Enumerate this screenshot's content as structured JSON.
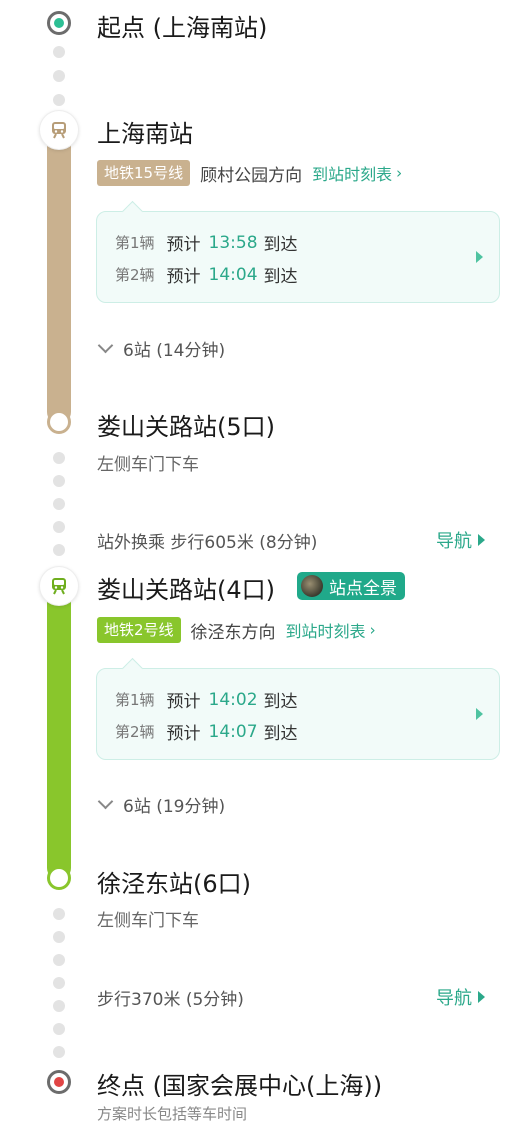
{
  "start": {
    "label": "起点 (上海南站)"
  },
  "segment1": {
    "station": "上海南站",
    "line": "地铁15号线",
    "direction": "顾村公园方向",
    "timetable": "到站时刻表",
    "arrivals": [
      {
        "idx": "第1辆",
        "pre": "预计",
        "time": "13:58",
        "suf": "到达"
      },
      {
        "idx": "第2辆",
        "pre": "预计",
        "time": "14:04",
        "suf": "到达"
      }
    ],
    "stops": "6站 (14分钟)",
    "exit_station": "娄山关路站(5口)",
    "door": "左侧车门下车",
    "color": "#c9b18f"
  },
  "transfer": {
    "text": "站外换乘 步行605米 (8分钟)",
    "nav": "导航"
  },
  "segment2": {
    "station": "娄山关路站(4口)",
    "panorama": "站点全景",
    "line": "地铁2号线",
    "direction": "徐泾东方向",
    "timetable": "到站时刻表",
    "arrivals": [
      {
        "idx": "第1辆",
        "pre": "预计",
        "time": "14:02",
        "suf": "到达"
      },
      {
        "idx": "第2辆",
        "pre": "预计",
        "time": "14:07",
        "suf": "到达"
      }
    ],
    "stops": "6站 (19分钟)",
    "exit_station": "徐泾东站(6口)",
    "door": "左侧车门下车",
    "color": "#89c62c"
  },
  "walk_end": {
    "text": "步行370米 (5分钟)",
    "nav": "导航"
  },
  "end": {
    "label": "终点 (国家会展中心(上海))"
  },
  "footnote": "方案时长包括等车时间",
  "accent": "#2ba88a"
}
